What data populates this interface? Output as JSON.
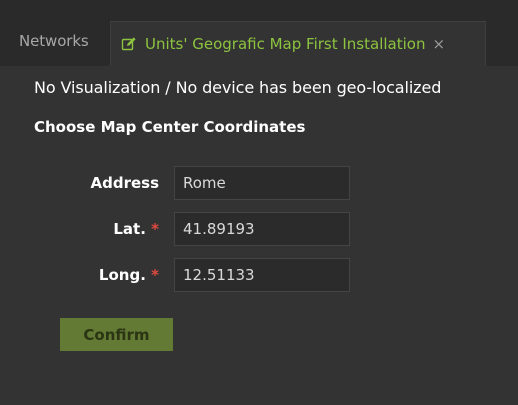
{
  "tabs": [
    {
      "label": "Networks"
    },
    {
      "label": "Units' Geografic Map First Installation",
      "icon": "edit-icon",
      "close": "×"
    }
  ],
  "main": {
    "message": "No Visualization / No device has been geo-localized",
    "section_title": "Choose Map Center Coordinates",
    "form": {
      "address": {
        "label": "Address",
        "value": "Rome"
      },
      "lat": {
        "label": "Lat.",
        "required_mark": "*",
        "value": "41.89193"
      },
      "long": {
        "label": "Long.",
        "required_mark": "*",
        "value": "12.51133"
      }
    },
    "confirm_label": "Confirm"
  },
  "colors": {
    "active_tab_text": "#8dc43f",
    "required": "#e04a3f",
    "confirm_bg": "#627a34",
    "background": "#333333"
  }
}
